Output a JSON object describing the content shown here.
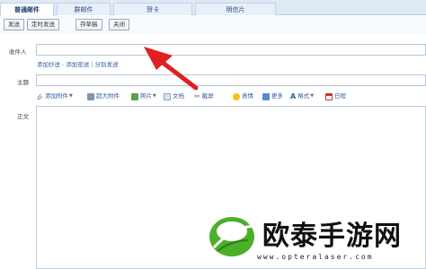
{
  "tabs": [
    {
      "label": "普通邮件",
      "active": true
    },
    {
      "label": "群邮件",
      "active": false
    },
    {
      "label": "贺卡",
      "active": false
    },
    {
      "label": "明信片",
      "active": false
    }
  ],
  "toolbar": {
    "send": "发送",
    "scheduled_send": "定时发送",
    "save_draft": "存草稿",
    "close": "关闭"
  },
  "form": {
    "recipient_label": "收件人",
    "recipient_value": "",
    "links": {
      "add_cc": "添加抄送",
      "add_bcc": "添加密送",
      "separate_send": "分别发送"
    },
    "subject_label": "主题",
    "subject_value": "",
    "body_label": "正文"
  },
  "format_toolbar": {
    "add_attachment": "添加附件",
    "large_attachment": "超大附件",
    "photo": "照片",
    "document": "文档",
    "screenshot": "截屏",
    "emoji": "表情",
    "more": "更多",
    "format": "格式",
    "calendar": "日程"
  },
  "watermark": {
    "title": "欧泰手游网",
    "url": "www.opteralaser.com"
  },
  "colors": {
    "arrow": "#e02020",
    "link": "#2b5ca8",
    "tab_bar": "#dfe9f5",
    "logo_green": "#4caf2a"
  },
  "icons": [
    "paperclip-icon",
    "large-attachment-icon",
    "photo-icon",
    "document-icon",
    "scissors-icon",
    "smiley-icon",
    "grid-icon",
    "format-icon",
    "calendar-icon",
    "red-arrow"
  ]
}
